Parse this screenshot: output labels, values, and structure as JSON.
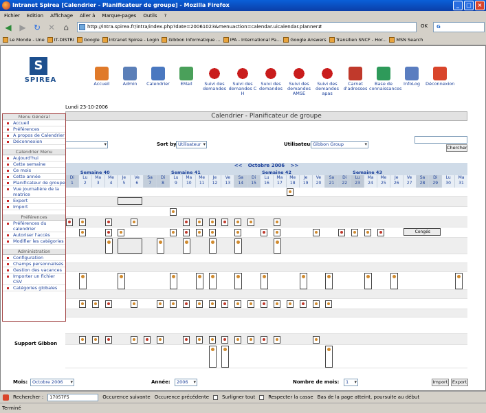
{
  "window": {
    "title": "Intranet Spirea [Calendrier - Planificateur de groupe] - Mozilla Firefox"
  },
  "menu": [
    "Fichier",
    "Edition",
    "Affichage",
    "Aller à",
    "Marque-pages",
    "Outils",
    "?"
  ],
  "url": "http://intra.spirea.fr/intra/index.php?date=20061023&menuaction=calendar.uicalendar.planner#",
  "go_label": "OK",
  "google_label": "G",
  "bookmarks": [
    "Le Monde - Une",
    "IT-DISTRI",
    "Google",
    "Intranet Spirea - Login",
    "Gibbon Informatique ...",
    "IPA - International Pa...",
    "Google Answers",
    "Transilien SNCF - Hor...",
    "MSN Search"
  ],
  "app": {
    "logo": "SPIREA",
    "nav": [
      "Accueil",
      "Admin",
      "Calendrier",
      "EMail",
      "Suivi des demandes",
      "Suivi des demandes C H",
      "Suivi des demandes",
      "Suivi des demandes AMSE",
      "Suivi des demandes apas",
      "Carnet d'adresses",
      "Base de connaissances",
      "InfoLog",
      "Déconnexion"
    ],
    "date": "Lundi 23-10-2006",
    "page_title": "Calendrier - Planificateur de groupe"
  },
  "filters": {
    "sort_label": "Sort by:",
    "sort_value": "Utilisateur",
    "users_label": "Utilisateurs",
    "users_value": "Gibbon Group",
    "search_button": "Chercher"
  },
  "sidemenu": {
    "sections": [
      {
        "title": "Menu Général",
        "items": [
          "Accueil",
          "Préférences",
          "A propos de Calendrier",
          "Déconnexion"
        ]
      },
      {
        "title": "Calendrier Menu",
        "items": [
          "Aujourd'hui",
          "Cette semaine",
          "Ce mois",
          "Cette année",
          "Planificateur de groupe",
          "Vue journalière de la matrice",
          "Export",
          "Import"
        ]
      },
      {
        "title": "Préférences",
        "items": [
          "Préférences du calendrier",
          "Autoriser l'accès",
          "Modifier les catégories"
        ]
      },
      {
        "title": "Administration",
        "items": [
          "Configuration",
          "Champs personnalisés",
          "Gestion des vacances",
          "Importer un fichier CSV",
          "Catégories globales"
        ]
      }
    ]
  },
  "calendar": {
    "month_label": "Octobre 2006",
    "prev": "<<",
    "next": ">>",
    "weeks": [
      "Semaine 40",
      "Semaine 41",
      "Semaine 42",
      "Semaine 43"
    ],
    "days": [
      {
        "d": "Di",
        "n": "1"
      },
      {
        "d": "Lu",
        "n": "2"
      },
      {
        "d": "Ma",
        "n": "3"
      },
      {
        "d": "Me",
        "n": "4"
      },
      {
        "d": "Je",
        "n": "5"
      },
      {
        "d": "Ve",
        "n": "6"
      },
      {
        "d": "Sa",
        "n": "7"
      },
      {
        "d": "Di",
        "n": "8"
      },
      {
        "d": "Lu",
        "n": "9"
      },
      {
        "d": "Ma",
        "n": "10"
      },
      {
        "d": "Me",
        "n": "11"
      },
      {
        "d": "Je",
        "n": "12"
      },
      {
        "d": "Ve",
        "n": "13"
      },
      {
        "d": "Sa",
        "n": "14"
      },
      {
        "d": "Di",
        "n": "15"
      },
      {
        "d": "Lu",
        "n": "16"
      },
      {
        "d": "Ma",
        "n": "17"
      },
      {
        "d": "Me",
        "n": "18"
      },
      {
        "d": "Je",
        "n": "19"
      },
      {
        "d": "Ve",
        "n": "20"
      },
      {
        "d": "Sa",
        "n": "21"
      },
      {
        "d": "Di",
        "n": "22"
      },
      {
        "d": "Lu",
        "n": "23"
      },
      {
        "d": "Ma",
        "n": "24"
      },
      {
        "d": "Me",
        "n": "25"
      },
      {
        "d": "Je",
        "n": "26"
      },
      {
        "d": "Ve",
        "n": "27"
      },
      {
        "d": "Sa",
        "n": "28"
      },
      {
        "d": "Di",
        "n": "29"
      },
      {
        "d": "Lu",
        "n": "30"
      },
      {
        "d": "Ma",
        "n": "31"
      }
    ],
    "conge_label": "Congés",
    "group_label": "Support Gibbon"
  },
  "footer": {
    "mois_label": "Mois:",
    "mois_value": "Octobre 2006",
    "annee_label": "Année:",
    "annee_value": "2006",
    "nombre_label": "Nombre de mois:",
    "nombre_value": "1",
    "import": "Import",
    "export": "Export"
  },
  "find": {
    "label": "Rechercher :",
    "value": "17057F5",
    "next": "Occurence suivante",
    "prev": "Occurence précédente",
    "highlight": "Surligner tout",
    "case": "Respecter la casse",
    "message": "Bas de la page atteint, poursuite au début"
  },
  "status": "Terminé"
}
